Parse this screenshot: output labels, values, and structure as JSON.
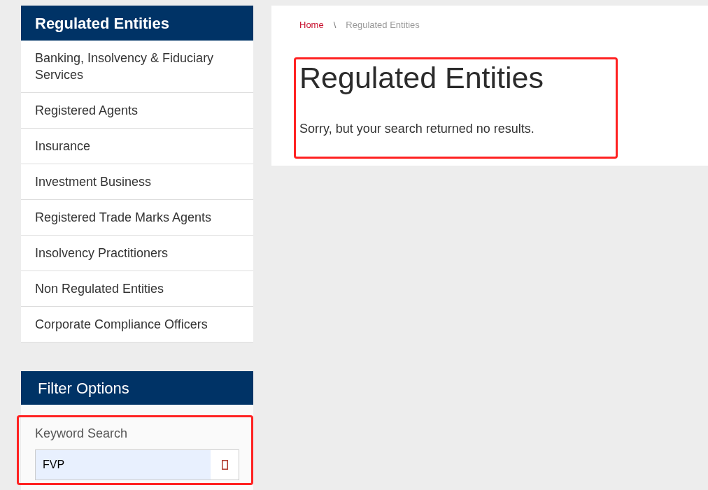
{
  "sidebar": {
    "title": "Regulated Entities",
    "items": [
      "Banking, Insolvency & Fiduciary Services",
      "Registered Agents",
      "Insurance",
      "Investment Business",
      "Registered Trade Marks Agents",
      "Insolvency Practitioners",
      "Non Regulated Entities",
      "Corporate Compliance Officers"
    ]
  },
  "filter": {
    "title": "Filter Options",
    "keyword_search": {
      "label": "Keyword Search",
      "value": "FVP",
      "highlighted": true
    }
  },
  "breadcrumb": {
    "items": [
      {
        "label": "Home",
        "kind": "link"
      },
      {
        "label": "Regulated Entities",
        "kind": "current"
      }
    ],
    "separator": "\\"
  },
  "main": {
    "title": "Regulated Entities",
    "message": "Sorry, but your search returned no results.",
    "highlighted": true
  }
}
